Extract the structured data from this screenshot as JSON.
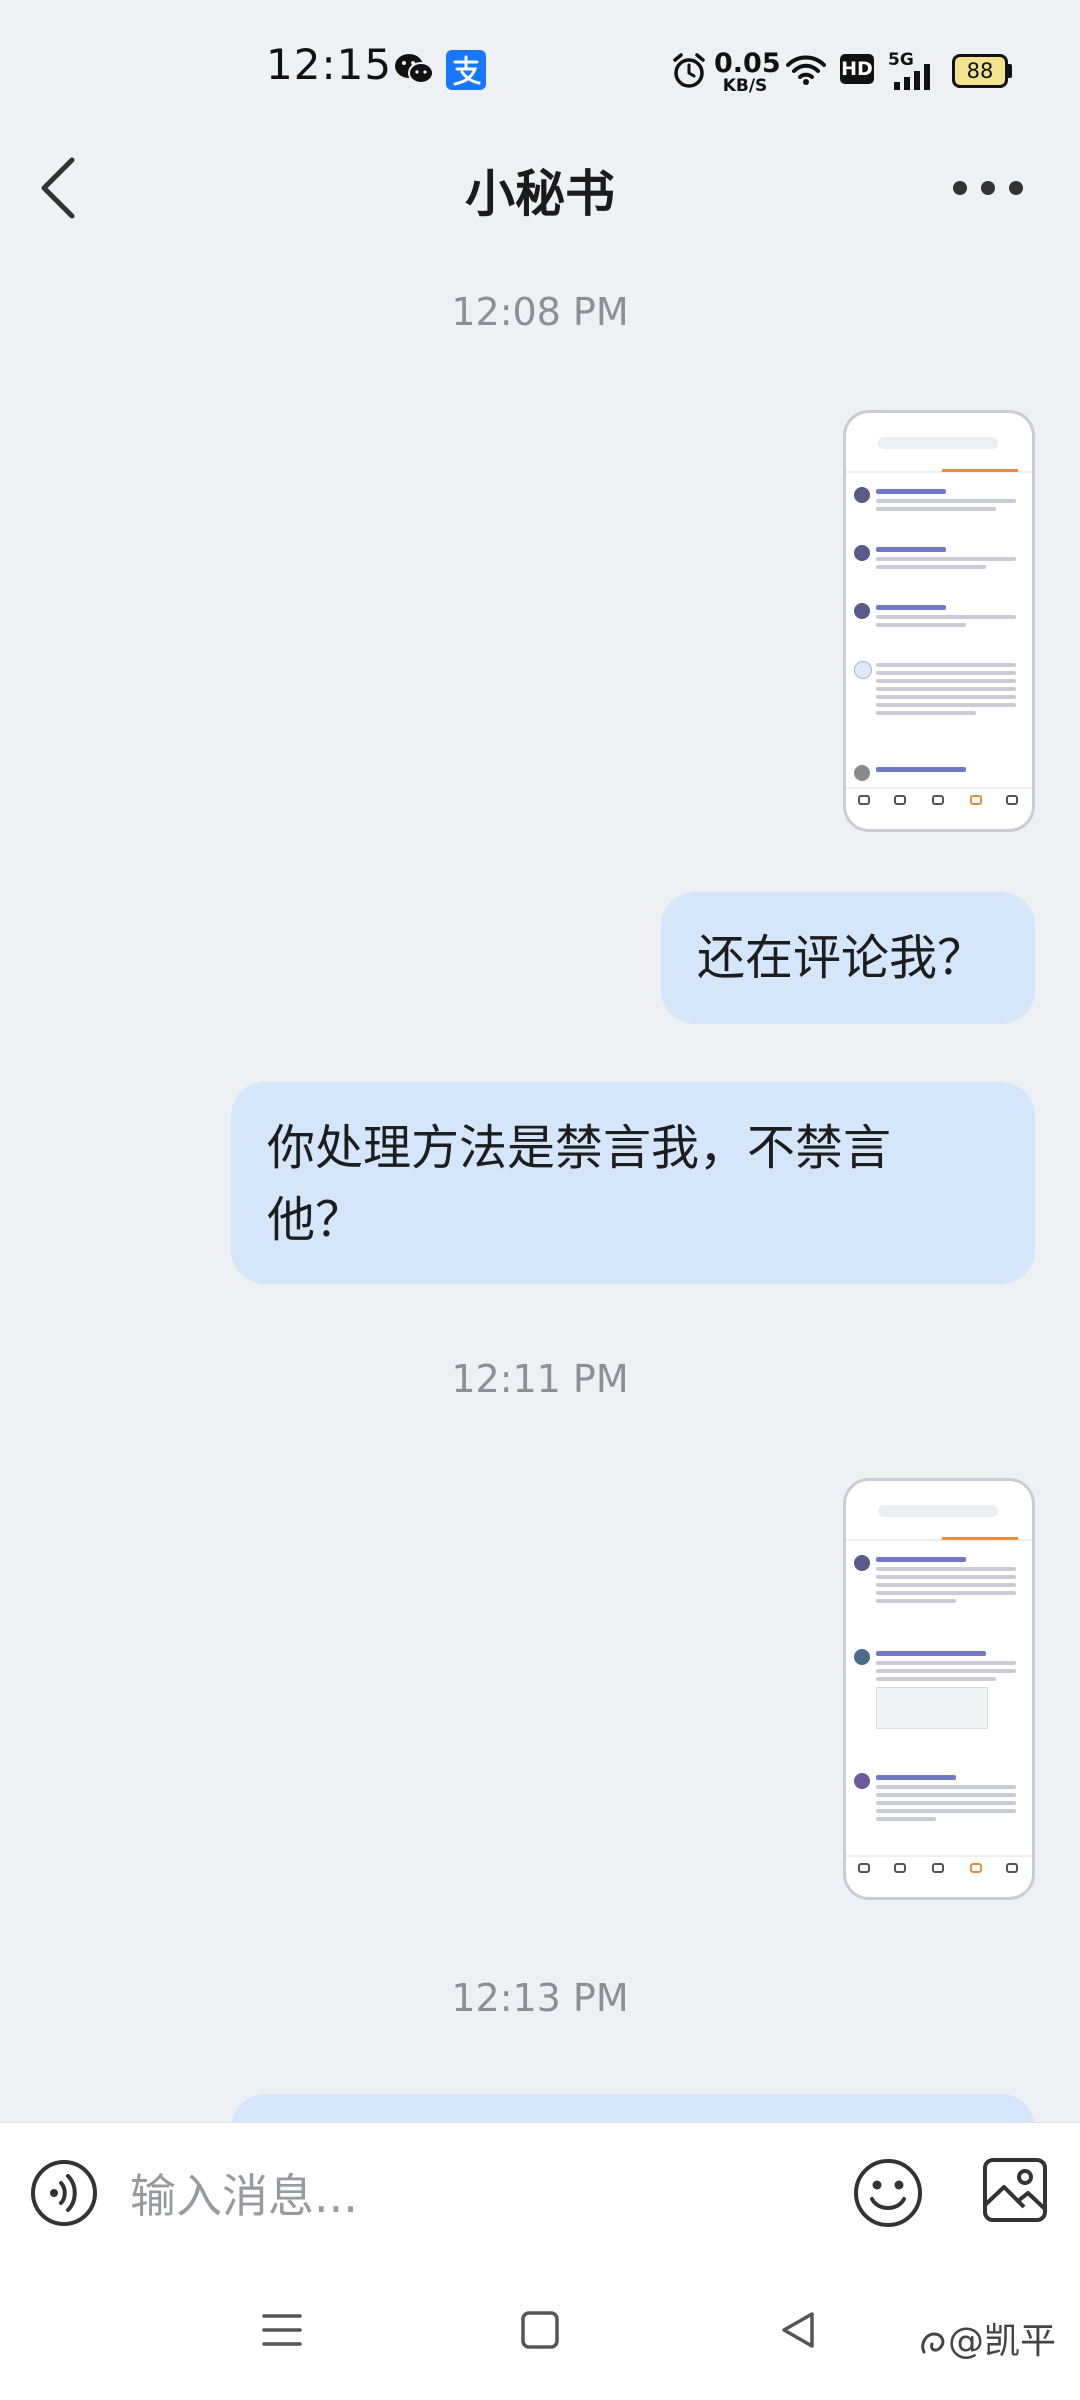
{
  "status_bar": {
    "time": "12:15",
    "net_speed_value": "0.05",
    "net_speed_unit": "KB/S",
    "hd_label": "HD",
    "network_label": "5G",
    "battery_level": "88",
    "icons": [
      "wechat-icon",
      "alipay-icon",
      "alarm-icon",
      "wifi-icon",
      "hd-icon",
      "signal-icon",
      "battery-icon"
    ]
  },
  "nav": {
    "title": "小秘书",
    "back_icon": "chevron-left-icon",
    "more_icon": "more-dots-icon"
  },
  "chat": {
    "messages": [
      {
        "type": "timestamp",
        "text": "12:08 PM"
      },
      {
        "type": "image",
        "sender": "me",
        "content": "screenshot of app notifications page"
      },
      {
        "type": "text",
        "sender": "me",
        "text": "还在评论我？"
      },
      {
        "type": "text",
        "sender": "me",
        "text": "你处理方法是禁言我，不禁言他？"
      },
      {
        "type": "timestamp",
        "text": "12:11 PM"
      },
      {
        "type": "image",
        "sender": "me",
        "content": "screenshot of app notifications page"
      },
      {
        "type": "timestamp",
        "text": "12:13 PM"
      }
    ]
  },
  "input": {
    "placeholder": "输入消息...",
    "value": ""
  },
  "system_nav": {
    "watermark": "@凯平"
  },
  "colors": {
    "background": "#eff0f3",
    "bubble": "#d4e6fb",
    "timestamp": "#8e8f94",
    "accent_orange": "#f08a3c"
  }
}
